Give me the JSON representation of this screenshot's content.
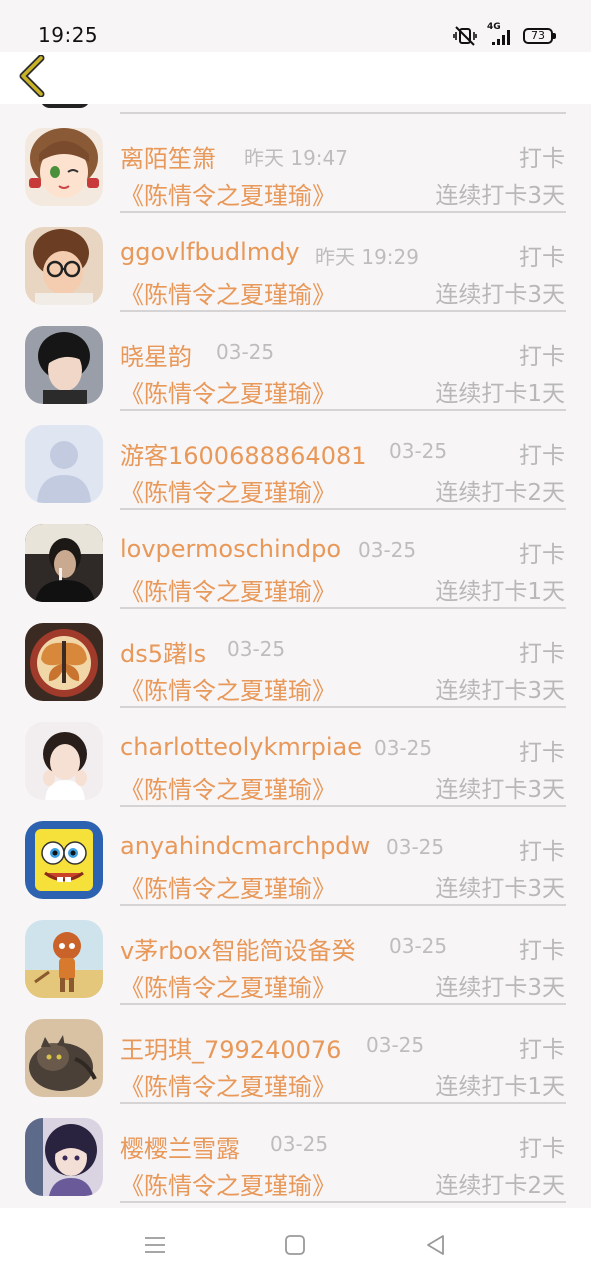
{
  "status": {
    "time": "19:25",
    "network": "4G",
    "battery": "73"
  },
  "header": {
    "back_icon": "chevron-left-icon"
  },
  "colors": {
    "accent": "#e89858",
    "muted": "#b8b8b8",
    "divider": "#d6d3d5",
    "back_arrow": "#c9b128"
  },
  "rows": [
    {
      "name": "离陌笙箫",
      "date": "昨天 19:47",
      "action": "打卡",
      "book": "《陈情令之夏瑾瑜》",
      "streak": "连续打卡3天"
    },
    {
      "name": "ggovlfbudlmdy",
      "date": "昨天 19:29",
      "action": "打卡",
      "book": "《陈情令之夏瑾瑜》",
      "streak": "连续打卡3天"
    },
    {
      "name": "晓星韵",
      "date": "03-25",
      "action": "打卡",
      "book": "《陈情令之夏瑾瑜》",
      "streak": "连续打卡1天"
    },
    {
      "name": "游客1600688864081",
      "date": "03-25",
      "action": "打卡",
      "book": "《陈情令之夏瑾瑜》",
      "streak": "连续打卡2天"
    },
    {
      "name": "lovpermoschindpo",
      "date": "03-25",
      "action": "打卡",
      "book": "《陈情令之夏瑾瑜》",
      "streak": "连续打卡1天"
    },
    {
      "name": "ds5躇ls",
      "date": "03-25",
      "action": "打卡",
      "book": "《陈情令之夏瑾瑜》",
      "streak": "连续打卡3天"
    },
    {
      "name": "charlotteolykmrpiae",
      "date": "03-25",
      "action": "打卡",
      "book": "《陈情令之夏瑾瑜》",
      "streak": "连续打卡3天"
    },
    {
      "name": "anyahindcmarchpdw",
      "date": "03-25",
      "action": "打卡",
      "book": "《陈情令之夏瑾瑜》",
      "streak": "连续打卡3天"
    },
    {
      "name": "v茅rbox智能简设备癸",
      "date": "03-25",
      "action": "打卡",
      "book": "《陈情令之夏瑾瑜》",
      "streak": "连续打卡3天"
    },
    {
      "name": "王玥琪_799240076",
      "date": "03-25",
      "action": "打卡",
      "book": "《陈情令之夏瑾瑜》",
      "streak": "连续打卡1天"
    },
    {
      "name": "樱樱兰雪露",
      "date": "03-25",
      "action": "打卡",
      "book": "《陈情令之夏瑾瑜》",
      "streak": "连续打卡2天"
    }
  ],
  "nav": {
    "menu_icon": "menu-icon",
    "home_icon": "home-square-icon",
    "back_icon": "back-triangle-icon"
  }
}
